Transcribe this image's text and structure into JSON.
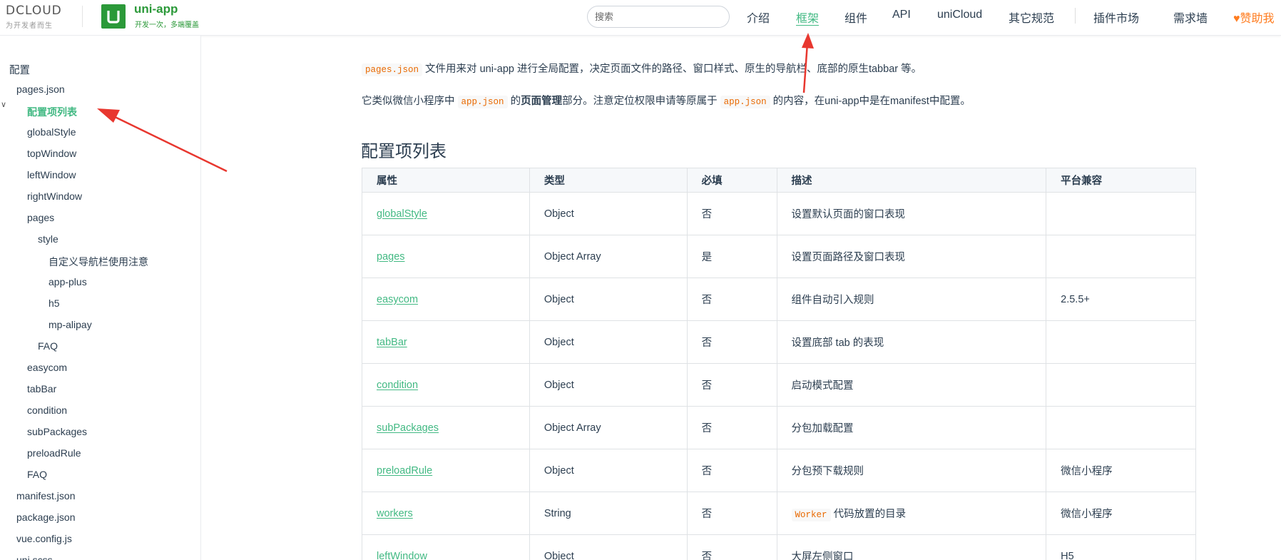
{
  "brand": {
    "dcloud_word": "DCLOUD",
    "dcloud_tagline": "为开发者而生",
    "uni_title": "uni-app",
    "uni_tagline": "开发一次，多端覆盖"
  },
  "nav": {
    "search_placeholder": "搜索",
    "links": [
      "介绍",
      "框架",
      "组件",
      "API",
      "uniCloud",
      "其它规范",
      "插件市场",
      "需求墙"
    ],
    "active": "框架",
    "sponsor": "赞助我"
  },
  "sidebar": {
    "items": [
      "配置",
      "pages.json",
      "配置项列表",
      "globalStyle",
      "topWindow",
      "leftWindow",
      "rightWindow",
      "pages",
      "style",
      "自定义导航栏使用注意",
      "app-plus",
      "h5",
      "mp-alipay",
      "FAQ",
      "easycom",
      "tabBar",
      "condition",
      "subPackages",
      "preloadRule",
      "FAQ",
      "manifest.json",
      "package.json",
      "vue.config.js",
      "uni.scss"
    ],
    "active": "配置项列表"
  },
  "content": {
    "p1": {
      "code": "pages.json",
      "text": " 文件用来对 uni-app 进行全局配置，决定页面文件的路径、窗口样式、原生的导航栏、底部的原生tabbar 等。"
    },
    "p2": {
      "pre": "它类似微信小程序中 ",
      "code1": "app.json",
      "mid1": " 的",
      "bold": "页面管理",
      "mid2": "部分。注意定位权限申请等原属于 ",
      "code2": "app.json",
      "post": " 的内容，在uni-app中是在manifest中配置。"
    },
    "heading": "配置项列表",
    "table": {
      "headers": [
        "属性",
        "类型",
        "必填",
        "描述",
        "平台兼容"
      ],
      "rows": [
        {
          "attr": "globalStyle",
          "type": "Object",
          "required": "否",
          "desc": "设置默认页面的窗口表现",
          "platform": ""
        },
        {
          "attr": "pages",
          "type": "Object Array",
          "required": "是",
          "desc": "设置页面路径及窗口表现",
          "platform": ""
        },
        {
          "attr": "easycom",
          "type": "Object",
          "required": "否",
          "desc": "组件自动引入规则",
          "platform": "2.5.5+"
        },
        {
          "attr": "tabBar",
          "type": "Object",
          "required": "否",
          "desc": "设置底部 tab 的表现",
          "platform": ""
        },
        {
          "attr": "condition",
          "type": "Object",
          "required": "否",
          "desc": "启动模式配置",
          "platform": ""
        },
        {
          "attr": "subPackages",
          "type": "Object Array",
          "required": "否",
          "desc": "分包加载配置",
          "platform": ""
        },
        {
          "attr": "preloadRule",
          "type": "Object",
          "required": "否",
          "desc": "分包预下载规则",
          "platform": "微信小程序"
        },
        {
          "attr": "workers",
          "type": "String",
          "required": "否",
          "desc_code": "Worker",
          "desc": " 代码放置的目录",
          "platform": "微信小程序"
        },
        {
          "attr": "leftWindow",
          "type": "Object",
          "required": "否",
          "desc": "大屏左侧窗口",
          "platform": "H5"
        }
      ]
    }
  },
  "colors": {
    "accent": "#42b983",
    "brand_green": "#2b9939",
    "annotation_arrow": "#e8372f",
    "sponsor": "#ff7c1f"
  }
}
